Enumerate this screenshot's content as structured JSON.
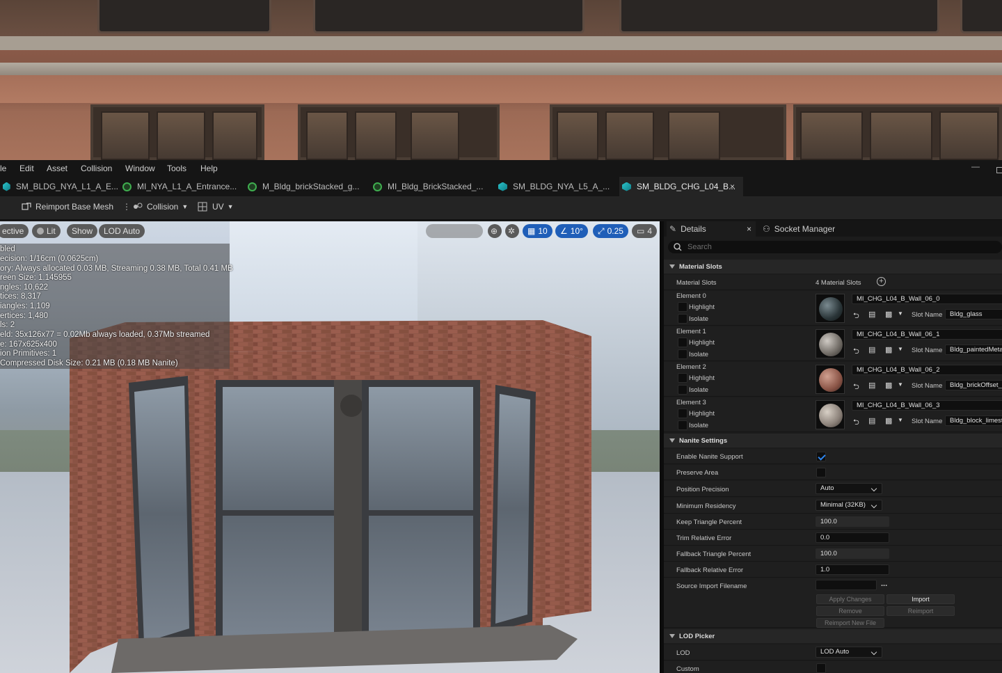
{
  "menu": [
    "le",
    "Edit",
    "Asset",
    "Collision",
    "Window",
    "Tools",
    "Help"
  ],
  "tabs": [
    {
      "label": "SM_BLDG_NYA_L1_A_E...",
      "icon": "mesh-icon"
    },
    {
      "label": "MI_NYA_L1_A_Entrance...",
      "icon": "material-icon"
    },
    {
      "label": "M_Bldg_brickStacked_g...",
      "icon": "material-icon"
    },
    {
      "label": "MI_Bldg_BrickStacked_...",
      "icon": "material-icon"
    },
    {
      "label": "SM_BLDG_NYA_L5_A_...",
      "icon": "mesh-icon"
    },
    {
      "label": "SM_BLDG_CHG_L04_B...",
      "icon": "mesh-icon",
      "active": true,
      "close": "×"
    }
  ],
  "window_controls": {
    "minimize": "—"
  },
  "toolbar": {
    "reimport": "Reimport Base Mesh",
    "collision": "Collision",
    "uv": "UV"
  },
  "viewport": {
    "perspective": "ective",
    "lit": "Lit",
    "show": "Show",
    "lod": "LOD Auto",
    "grid_snap": "10",
    "rot_snap": "10°",
    "scale_snap": "0.25",
    "camera_speed": "4",
    "stats": [
      "bled",
      "ecision: 1/16cm (0.0625cm)",
      "ory: Always allocated 0.03 MB, Streaming 0.38 MB, Total 0.41 MB",
      "reen Size: 1.145955",
      "ngles:  10,622",
      "tices:  8,317",
      "iangles:  1,109",
      "ertices:  1,480",
      "ls:  2",
      "eld:  35x126x77 = 0.02Mb always loaded, 0.37Mb streamed",
      "e: 167x625x400",
      "ion Primitives:  1",
      "Compressed Disk Size: 0.21 MB (0.18 MB Nanite)"
    ]
  },
  "panel": {
    "details_tab": "Details",
    "details_close": "×",
    "socket_tab": "Socket Manager",
    "search_placeholder": "Search",
    "material_slots_header": "Material Slots",
    "material_slots_label": "Material Slots",
    "material_slots_count": "4 Material Slots",
    "highlight": "Highlight",
    "isolate": "Isolate",
    "slot_name_label": "Slot Name",
    "elements": [
      {
        "label": "Element 0",
        "material": "MI_CHG_L04_B_Wall_06_0",
        "slot": "Bldg_glass",
        "color": "#3a4a4f"
      },
      {
        "label": "Element 1",
        "material": "MI_CHG_L04_B_Wall_06_1",
        "slot": "Bldg_paintedMetal_",
        "color": "#8a8680"
      },
      {
        "label": "Element 2",
        "material": "MI_CHG_L04_B_Wall_06_2",
        "slot": "Bldg_brickOffset_b",
        "color": "#8e5a4a"
      },
      {
        "label": "Element 3",
        "material": "MI_CHG_L04_B_Wall_06_3",
        "slot": "Bldg_block_limesto",
        "color": "#9a928a"
      }
    ],
    "nanite_header": "Nanite Settings",
    "nanite": {
      "enable_label": "Enable Nanite Support",
      "enable": true,
      "preserve_label": "Preserve Area",
      "preserve": false,
      "position_precision_label": "Position Precision",
      "position_precision": "Auto",
      "min_residency_label": "Minimum Residency",
      "min_residency": "Minimal (32KB)",
      "keep_tri_label": "Keep Triangle Percent",
      "keep_tri": "100.0",
      "trim_label": "Trim Relative Error",
      "trim": "0.0",
      "fallback_tri_label": "Fallback Triangle Percent",
      "fallback_tri": "100.0",
      "fallback_err_label": "Fallback Relative Error",
      "fallback_err": "1.0",
      "source_label": "Source Import Filename",
      "source": "",
      "browse": "...",
      "apply": "Apply Changes",
      "import": "Import",
      "remove": "Remove",
      "reimport": "Reimport",
      "reimport_new": "Reimport New File"
    },
    "lod_header": "LOD Picker",
    "lod_label": "LOD",
    "lod_value": "LOD Auto",
    "custom_label": "Custom"
  }
}
